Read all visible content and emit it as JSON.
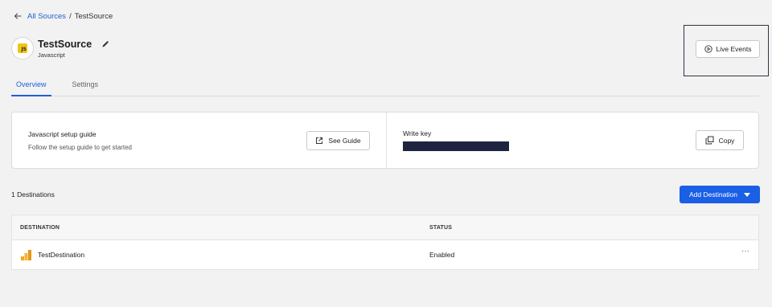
{
  "breadcrumb": {
    "link_label": "All Sources",
    "separator": "/",
    "current": "TestSource"
  },
  "source": {
    "name": "TestSource",
    "type": "Javascript",
    "badge": "JS"
  },
  "header": {
    "live_events_label": "Live Events"
  },
  "tabs": [
    {
      "label": "Overview",
      "active": true
    },
    {
      "label": "Settings",
      "active": false
    }
  ],
  "setup": {
    "title": "Javascript setup guide",
    "subtitle": "Follow the setup guide to get started",
    "see_guide_label": "See Guide",
    "write_key_label": "Write key",
    "copy_label": "Copy"
  },
  "destinations": {
    "count_label": "1 Destinations",
    "add_label": "Add Destination",
    "columns": [
      "DESTINATION",
      "STATUS"
    ],
    "rows": [
      {
        "name": "TestDestination",
        "status": "Enabled",
        "more": "···"
      }
    ]
  },
  "colors": {
    "accent": "#1a5fe5",
    "link": "#1f5fd6",
    "js_badge": "#f0c418",
    "redacted_key": "#1e2440",
    "destination_icon": "#f4a81d"
  },
  "icons": [
    "back-arrow-icon",
    "js-icon",
    "pencil-icon",
    "play-circle-icon",
    "external-link-icon",
    "copy-icon",
    "caret-down-icon",
    "bar-chart-icon",
    "more-icon"
  ]
}
